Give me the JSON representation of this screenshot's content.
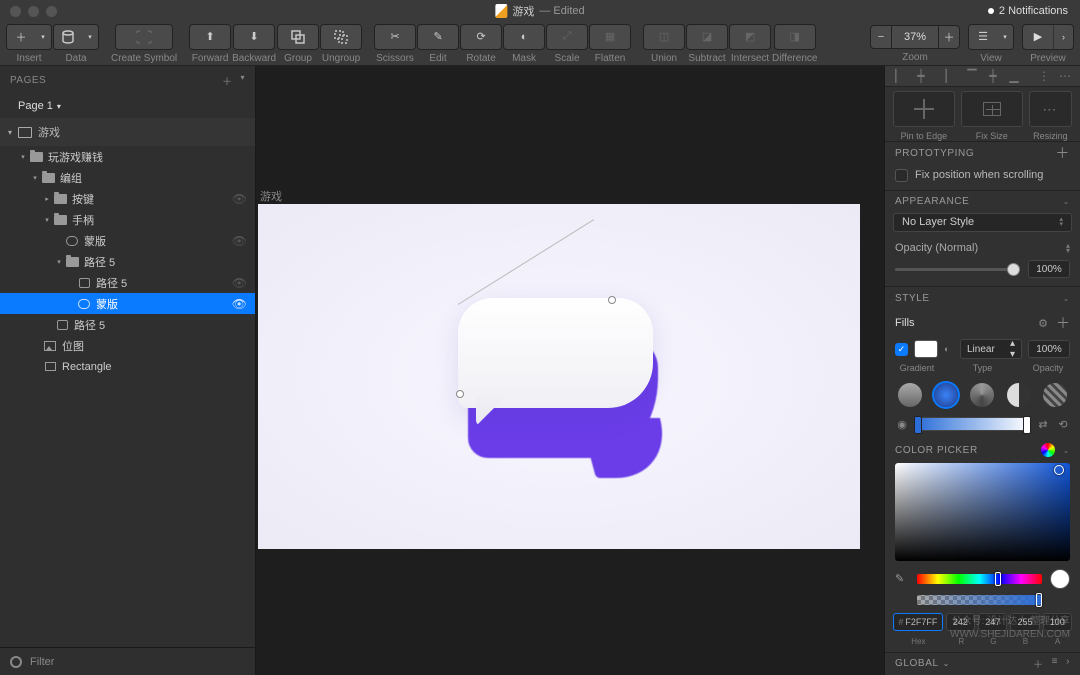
{
  "window": {
    "title": "游戏",
    "suffix": "— Edited",
    "notifications": "2 Notifications"
  },
  "toolbar": {
    "insert": "Insert",
    "data": "Data",
    "create_symbol": "Create Symbol",
    "forward": "Forward",
    "backward": "Backward",
    "group": "Group",
    "ungroup": "Ungroup",
    "scissors": "Scissors",
    "edit": "Edit",
    "rotate": "Rotate",
    "mask": "Mask",
    "scale": "Scale",
    "flatten": "Flatten",
    "union": "Union",
    "subtract": "Subtract",
    "intersect": "Intersect",
    "difference": "Difference",
    "zoom_label": "Zoom",
    "zoom_value": "37%",
    "view": "View",
    "preview": "Preview"
  },
  "pages": {
    "header": "PAGES",
    "page1": "Page 1",
    "artboard": "游戏"
  },
  "layers": {
    "l1": "玩游戏赚钱",
    "l2": "编组",
    "l3": "按键",
    "l4": "手柄",
    "l5": "蒙版",
    "l6": "路径 5",
    "l7": "路径 5",
    "l8": "蒙版",
    "l9": "路径 5",
    "l10": "位图",
    "l11": "Rectangle"
  },
  "filter": "Filter",
  "canvas": {
    "artboard_label": "游戏"
  },
  "inspector": {
    "pin_edge": "Pin to Edge",
    "fix_size": "Fix Size",
    "resizing": "Resizing",
    "prototyping": "PROTOTYPING",
    "fix_scroll": "Fix position when scrolling",
    "appearance": "APPEARANCE",
    "no_style": "No Layer Style",
    "opacity_label": "Opacity (Normal)",
    "opacity_val": "100%",
    "style": "STYLE",
    "fills": "Fills",
    "fill_type": "Linear",
    "fill_opacity": "100%",
    "gradient_lbl": "Gradient",
    "type_lbl": "Type",
    "opacity_lbl": "Opacity",
    "color_picker": "COLOR PICKER",
    "hex": "F2F7FF",
    "r": "242",
    "g": "247",
    "b": "255",
    "a": "100",
    "hex_l": "Hex",
    "r_l": "R",
    "g_l": "G",
    "b_l": "B",
    "a_l": "A",
    "global": "GLOBAL"
  },
  "watermark": {
    "line1": "公众号: 设计达人 整理分享",
    "line2": "WWW.SHEJIDAREN.COM"
  }
}
